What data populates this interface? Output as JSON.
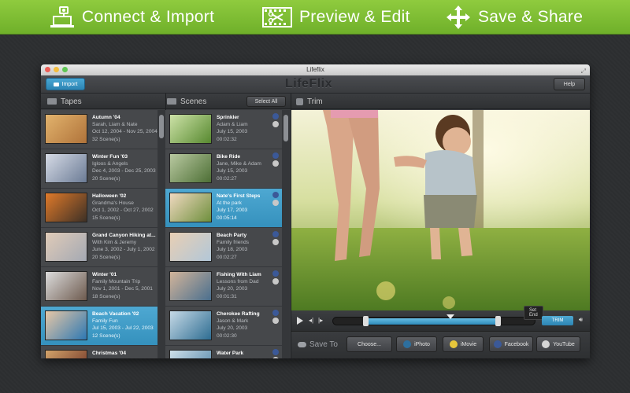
{
  "banner": {
    "steps": [
      {
        "label": "Connect & Import",
        "icon": "camera-laptop-icon"
      },
      {
        "label": "Preview & Edit",
        "icon": "scissors-film-icon"
      },
      {
        "label": "Save & Share",
        "icon": "move-arrows-icon"
      }
    ]
  },
  "window": {
    "title": "Lifeflix",
    "logo": "LifeFlix",
    "import_label": "Import",
    "help_label": "Help"
  },
  "headers": {
    "tapes": "Tapes",
    "scenes": "Scenes",
    "select_all": "Select All",
    "trim": "Trim"
  },
  "tapes": [
    {
      "name": "Autumn '04",
      "people": "Sarah, Liam & Nate",
      "dates": "Oct 12, 2004 - Nov 25, 2004",
      "count": "32 Scene(s)",
      "colors": [
        "#b0733a",
        "#e2b36d"
      ]
    },
    {
      "name": "Winter Fun '03",
      "people": "Igloos & Angels",
      "dates": "Dec 4, 2003 - Dec 25, 2003",
      "count": "20 Scene(s)",
      "colors": [
        "#6b7b95",
        "#d6dbe6"
      ]
    },
    {
      "name": "Halloween '02",
      "people": "Grandma's House",
      "dates": "Oct 1, 2002 - Oct 27, 2002",
      "count": "15 Scene(s)",
      "colors": [
        "#3d3026",
        "#e07a2a"
      ]
    },
    {
      "name": "Grand Canyon Hiking at...",
      "people": "With Kim & Jeremy",
      "dates": "June 3, 2002 - July 1, 2002",
      "count": "20 Scene(s)",
      "colors": [
        "#a4a9b3",
        "#e0cbb8"
      ]
    },
    {
      "name": "Winter '01",
      "people": "Family Mountain Trip",
      "dates": "Nov 1, 2001 - Dec 5, 2001",
      "count": "18 Scene(s)",
      "colors": [
        "#6d5a4e",
        "#dcdcdc"
      ]
    },
    {
      "name": "Beach Vacation '02",
      "people": "Family Fun",
      "dates": "Jul 15, 2003 - Jul 22, 2003",
      "count": "12 Scene(s)",
      "colors": [
        "#2d78b3",
        "#e7c7a6"
      ],
      "selected": true
    },
    {
      "name": "Christmas '04",
      "people": "",
      "dates": "",
      "count": "",
      "colors": [
        "#6a2d22",
        "#d2a36a"
      ]
    }
  ],
  "scenes": [
    {
      "name": "Sprinkler",
      "people": "Adam & Liam",
      "date": "July 15, 2003",
      "time": "00:02:32",
      "colors": [
        "#57892f",
        "#cde2a8"
      ]
    },
    {
      "name": "Bike Ride",
      "people": "Jane, Mike & Adam",
      "date": "July 15, 2003",
      "time": "00:02:27",
      "colors": [
        "#4d6f35",
        "#b9c9a1"
      ]
    },
    {
      "name": "Nate's First Steps",
      "people": "At the park",
      "date": "July 17, 2003",
      "time": "00:05:14",
      "colors": [
        "#6e8f3c",
        "#f0d9c0"
      ],
      "selected": true
    },
    {
      "name": "Beach Party",
      "people": "Family friends",
      "date": "July 18, 2003",
      "time": "00:02:27",
      "colors": [
        "#b2c7d8",
        "#e8cfb4"
      ]
    },
    {
      "name": "Fishing With Liam",
      "people": "Lessons from Dad",
      "date": "July 20, 2003",
      "time": "00:01:31",
      "colors": [
        "#4a6f8e",
        "#d2b49a"
      ]
    },
    {
      "name": "Cherokee Rafting",
      "people": "Jason & Mark",
      "date": "July 20, 2003",
      "time": "00:02:30",
      "colors": [
        "#2e6d92",
        "#c6d9e6"
      ]
    },
    {
      "name": "Water Park",
      "people": "",
      "date": "",
      "time": "",
      "colors": [
        "#4a7fa3",
        "#cfe0ea"
      ]
    }
  ],
  "trim": {
    "tooltip": "Set End",
    "trim_label": "TRIM"
  },
  "save": {
    "label": "Save To",
    "choose_label": "Choose...",
    "targets": [
      "iPhoto",
      "iMovie",
      "Facebook",
      "YouTube"
    ]
  },
  "colors": {
    "banner_green": "#7dbd33",
    "accent_blue": "#3591bd"
  }
}
